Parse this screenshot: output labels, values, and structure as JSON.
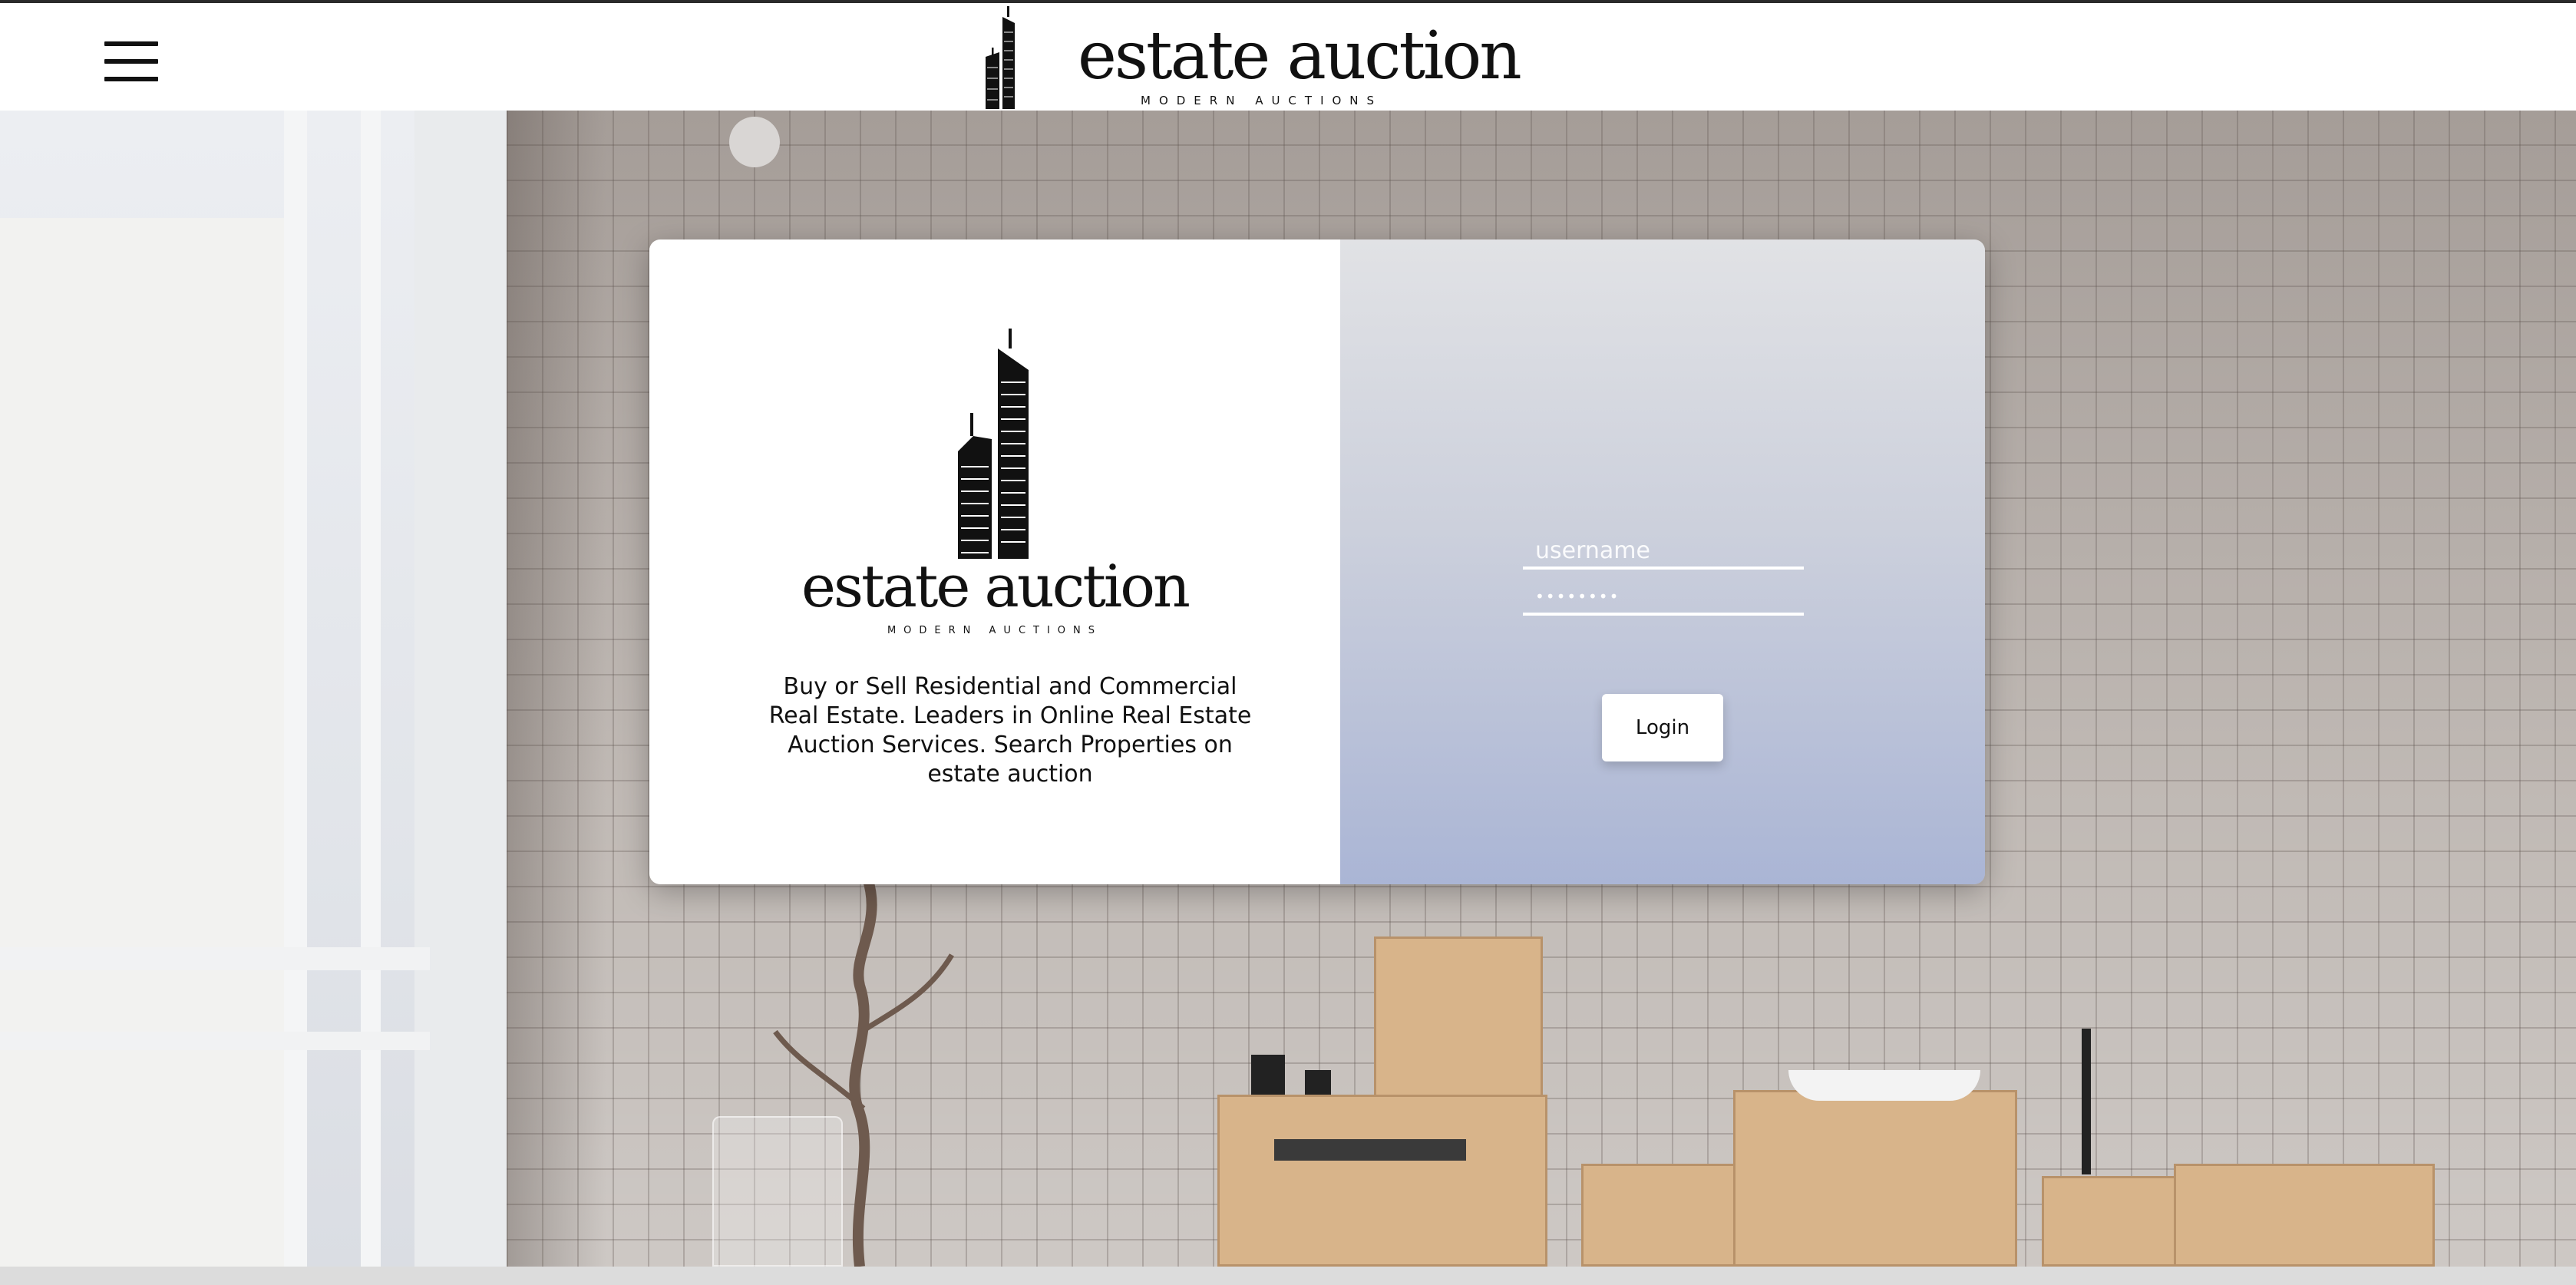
{
  "header": {
    "menu_icon": "hamburger-menu-icon",
    "logo_icon": "skyscraper-logo-icon",
    "brand_name": "estate auction",
    "tagline": "MODERN AUCTIONS"
  },
  "login_card": {
    "logo_icon": "skyscraper-logo-icon",
    "brand_name": "estate auction",
    "tagline": "MODERN AUCTIONS",
    "description": "Buy or Sell Residential and Commercial Real Estate. Leaders in Online Real Estate Auction Services. Search Properties on estate auction",
    "username_placeholder": "username",
    "password_value": "••••••••",
    "login_label": "Login"
  },
  "colors": {
    "panel_gradient_top": "#e1e2e5",
    "panel_gradient_bottom": "#aab5d5",
    "text": "#111111"
  }
}
